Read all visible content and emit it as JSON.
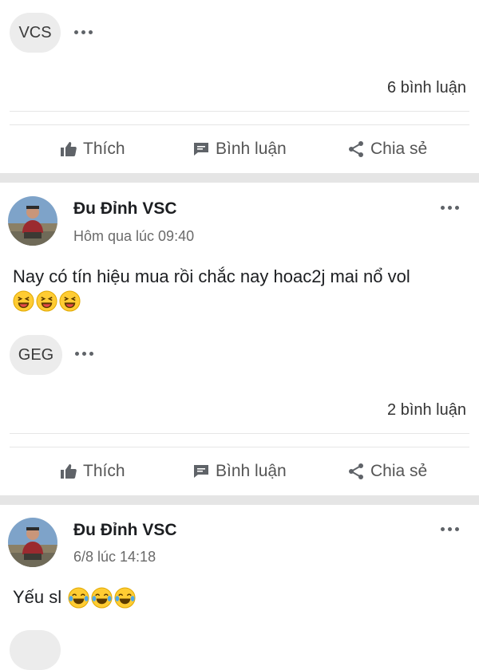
{
  "top_post": {
    "chip_label": "VCS",
    "comments_count": "6 bình luận"
  },
  "actions": {
    "like": "Thích",
    "comment": "Bình luận",
    "share": "Chia sẻ"
  },
  "post_1": {
    "author": "Đu Đỉnh VSC",
    "time": "Hôm qua lúc 09:40",
    "text": "Nay có tín hiệu mua rồi chắc nay hoac2j mai nổ vol",
    "emojis": [
      "grinning-squinting-face",
      "grinning-squinting-face",
      "grinning-squinting-face"
    ],
    "chip_label": "GEG",
    "comments_count": "2 bình luận"
  },
  "post_2": {
    "author": "Đu Đỉnh VSC",
    "time": "6/8 lúc 14:18",
    "text": "Yếu sl",
    "emojis": [
      "tears-of-joy-face",
      "tears-of-joy-face",
      "tears-of-joy-face"
    ]
  },
  "colors": {
    "separator": "#e5e5e5",
    "chip_bg": "#ececec",
    "icon": "#5f6368"
  }
}
